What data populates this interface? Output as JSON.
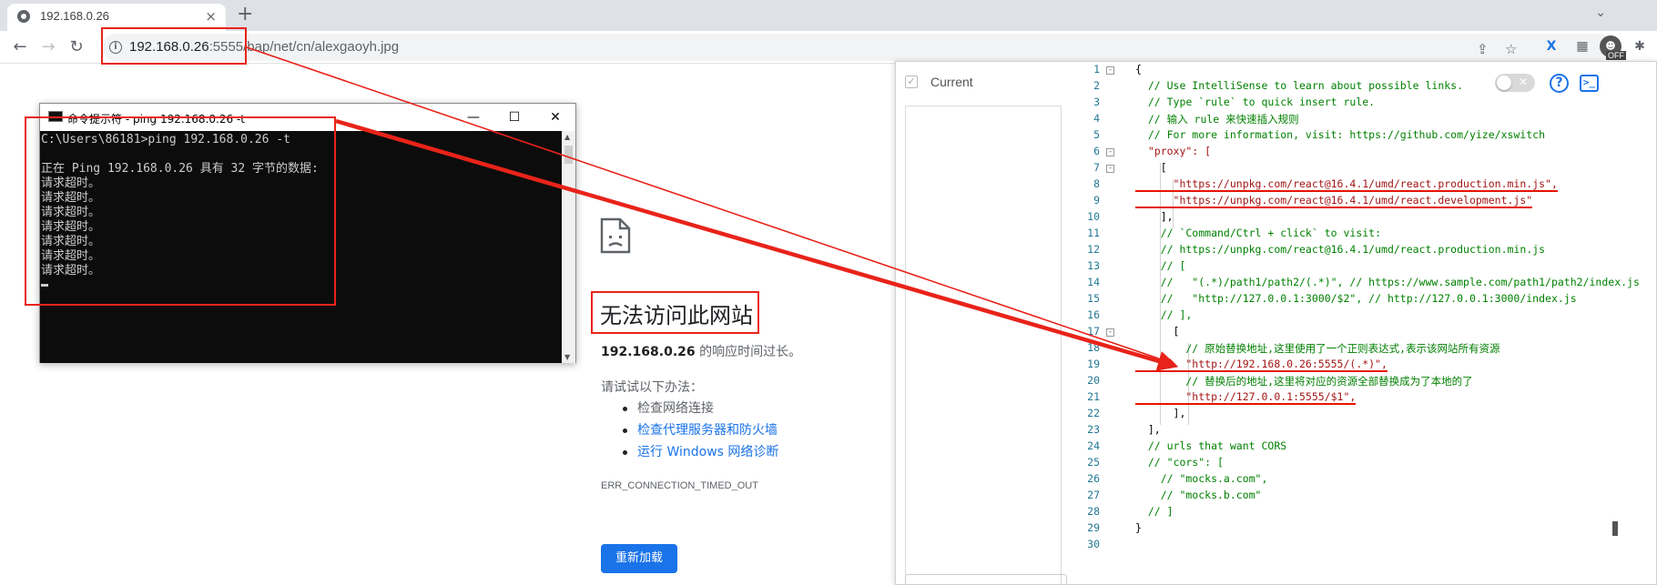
{
  "browser": {
    "tab_title": "192.168.0.26",
    "tab_close": "×",
    "new_tab": "+",
    "tab_search": "⌄",
    "back": "←",
    "forward": "→",
    "reload": "↻",
    "url_host": "192.168.0.26",
    "url_rest": ":5555/bap/net/cn/alexgaoyh.jpg"
  },
  "error_page": {
    "title": "无法访问此网站",
    "desc_host": "192.168.0.26",
    "desc_rest": " 的响应时间过长。",
    "try_label": "请试试以下办法：",
    "suggestions": [
      {
        "label": "检查网络连接",
        "link": false
      },
      {
        "label": "检查代理服务器和防火墙",
        "link": true
      },
      {
        "label": "运行 Windows 网络诊断",
        "link": true
      }
    ],
    "error_code": "ERR_CONNECTION_TIMED_OUT",
    "reload_label": "重新加载"
  },
  "cmd": {
    "title": "命令提示符 - ping  192.168.0.26 -t",
    "minimize": "—",
    "maximize": "☐",
    "close": "✕",
    "output": [
      "C:\\Users\\86181>ping 192.168.0.26 -t",
      "",
      "正在 Ping 192.168.0.26 具有 32 字节的数据:",
      "请求超时。",
      "请求超时。",
      "请求超时。",
      "请求超时。",
      "请求超时。",
      "请求超时。",
      "请求超时。"
    ]
  },
  "xswitch": {
    "current_label": "Current",
    "toggle_off": "✕",
    "help": "?",
    "terminal": ">_",
    "off_badge": "OFF",
    "code_lines": [
      {
        "n": "1",
        "fold": "-",
        "text": "{",
        "cls": ""
      },
      {
        "n": "2",
        "fold": "",
        "text": "  // Use IntelliSense to learn about possible links.",
        "cls": "c-cm"
      },
      {
        "n": "3",
        "fold": "",
        "text": "  // Type `rule` to quick insert rule.",
        "cls": "c-cm"
      },
      {
        "n": "4",
        "fold": "",
        "text": "  // 输入 rule 来快速插入规则",
        "cls": "c-cm"
      },
      {
        "n": "5",
        "fold": "",
        "text": "  // For more information, visit: https://github.com/yize/xswitch",
        "cls": "c-cm"
      },
      {
        "n": "6",
        "fold": "-",
        "text": "  \"proxy\": [",
        "cls": "c-str"
      },
      {
        "n": "7",
        "fold": "-",
        "text": "    [",
        "cls": ""
      },
      {
        "n": "8",
        "fold": "",
        "text": "      \"https://unpkg.com/react@16.4.1/umd/react.production.min.js\",",
        "cls": "c-str"
      },
      {
        "n": "9",
        "fold": "",
        "text": "      \"https://unpkg.com/react@16.4.1/umd/react.development.js\"",
        "cls": "c-str"
      },
      {
        "n": "10",
        "fold": "",
        "text": "    ],",
        "cls": ""
      },
      {
        "n": "11",
        "fold": "",
        "text": "    // `Command/Ctrl + click` to visit:",
        "cls": "c-cm"
      },
      {
        "n": "12",
        "fold": "",
        "text": "    // https://unpkg.com/react@16.4.1/umd/react.production.min.js",
        "cls": "c-cm"
      },
      {
        "n": "13",
        "fold": "",
        "text": "    // [",
        "cls": "c-cm"
      },
      {
        "n": "14",
        "fold": "",
        "text": "    //   \"(.*)/path1/path2/(.*)\", // https://www.sample.com/path1/path2/index.js",
        "cls": "c-cm"
      },
      {
        "n": "15",
        "fold": "",
        "text": "    //   \"http://127.0.0.1:3000/$2\", // http://127.0.0.1:3000/index.js",
        "cls": "c-cm"
      },
      {
        "n": "16",
        "fold": "",
        "text": "    // ],",
        "cls": "c-cm"
      },
      {
        "n": "17",
        "fold": "-",
        "text": "      [",
        "cls": ""
      },
      {
        "n": "18",
        "fold": "",
        "text": "        // 原始替换地址,这里使用了一个正则表达式,表示该网站所有资源",
        "cls": "c-cm"
      },
      {
        "n": "19",
        "fold": "",
        "text": "        \"http://192.168.0.26:5555/(.*)\",",
        "cls": "c-str"
      },
      {
        "n": "20",
        "fold": "",
        "text": "        // 替换后的地址,这里将对应的资源全部替换成为了本地的了",
        "cls": "c-cm"
      },
      {
        "n": "21",
        "fold": "",
        "text": "        \"http://127.0.0.1:5555/$1\",",
        "cls": "c-str"
      },
      {
        "n": "22",
        "fold": "",
        "text": "      ],",
        "cls": ""
      },
      {
        "n": "23",
        "fold": "",
        "text": "  ],",
        "cls": ""
      },
      {
        "n": "24",
        "fold": "",
        "text": "  // urls that want CORS",
        "cls": "c-cm"
      },
      {
        "n": "25",
        "fold": "",
        "text": "  // \"cors\": [",
        "cls": "c-cm"
      },
      {
        "n": "26",
        "fold": "",
        "text": "    // \"mocks.a.com\",",
        "cls": "c-cm"
      },
      {
        "n": "27",
        "fold": "",
        "text": "    // \"mocks.b.com\"",
        "cls": "c-cm"
      },
      {
        "n": "28",
        "fold": "",
        "text": "  // ]",
        "cls": "c-cm"
      },
      {
        "n": "29",
        "fold": "",
        "text": "}",
        "cls": ""
      },
      {
        "n": "30",
        "fold": "",
        "text": "",
        "cls": ""
      }
    ]
  },
  "colors": {
    "annotation_red": "#e8231a",
    "link_blue": "#1a73e8",
    "cmd_bg": "#0c0c0c"
  }
}
